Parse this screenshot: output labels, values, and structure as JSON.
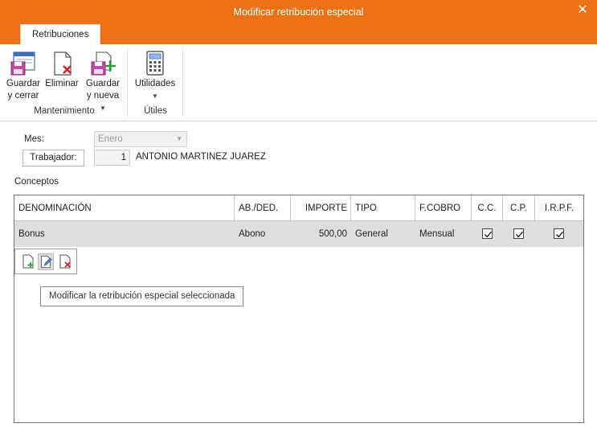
{
  "window": {
    "title": "Modificar retribución especial",
    "close_symbol": "✕"
  },
  "ribbon": {
    "tab": "Retribuciones",
    "buttons": {
      "save_close": {
        "line1": "Guardar",
        "line2": "y cerrar"
      },
      "delete": {
        "line1": "Eliminar"
      },
      "save_new": {
        "line1": "Guardar",
        "line2": "y nueva"
      },
      "utilities": {
        "line1": "Utilidades"
      }
    },
    "groups": {
      "maintenance": "Mantenimiento",
      "tools": "Útiles"
    }
  },
  "form": {
    "month_label": "Mes:",
    "month_value": "Enero",
    "worker_button": "Trabajador:",
    "worker_code": "1",
    "worker_name": "ANTONIO MARTINEZ JUAREZ"
  },
  "concepts": {
    "section_label": "Conceptos",
    "columns": [
      "DENOMINACIÓN",
      "AB./DED.",
      "IMPORTE",
      "TIPO",
      "F.COBRO",
      "C.C.",
      "C.P.",
      "I.R.P.F."
    ],
    "rows": [
      {
        "denominacion": "Bonus",
        "abded": "Abono",
        "importe": "500,00",
        "tipo": "General",
        "fcobro": "Mensual",
        "cc": true,
        "cp": true,
        "irpf": true
      }
    ],
    "tooltip": "Modificar la retribución especial seleccionada"
  },
  "colors": {
    "accent": "#ec7014",
    "selected_row": "#dedede"
  }
}
